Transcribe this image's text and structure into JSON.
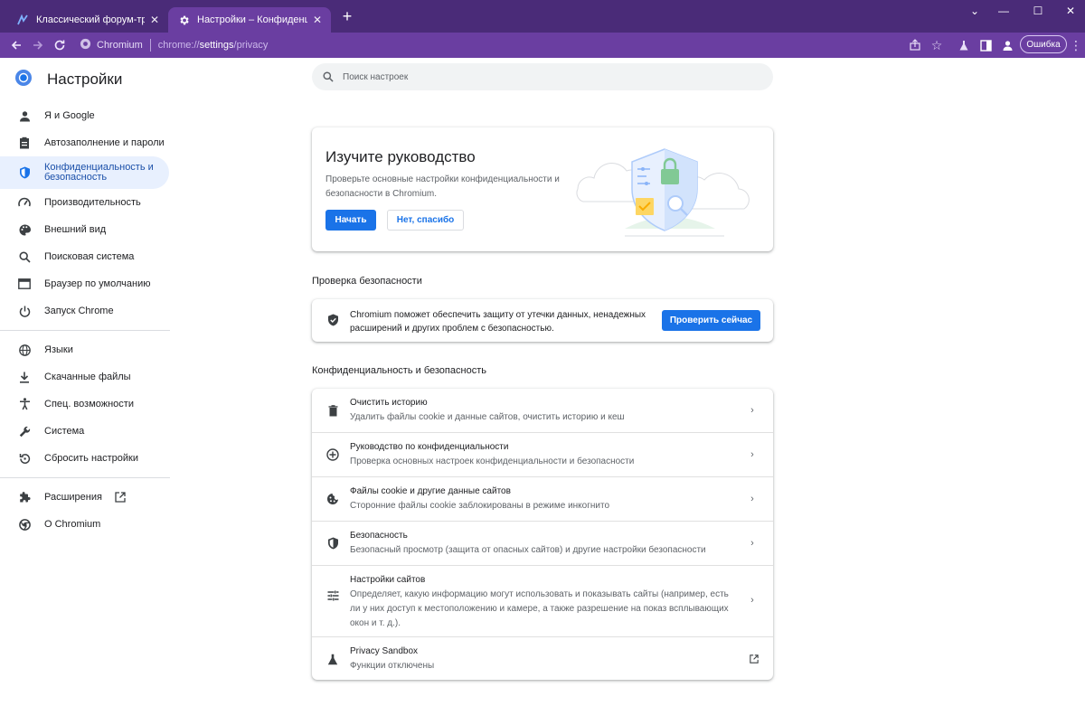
{
  "browser": {
    "tabs": [
      {
        "title": "Классический форум-трекер а",
        "active": false
      },
      {
        "title": "Настройки – Конфиденциальнс",
        "active": true
      }
    ],
    "omnibox": {
      "site": "Chromium",
      "url_prefix": "chrome://",
      "url_path": "settings",
      "url_suffix": "/privacy"
    },
    "error_button": "Ошибка",
    "colors": {
      "frame": "#4a2b78",
      "toolbar": "#6a3ea1"
    }
  },
  "sidebar": {
    "title": "Настройки",
    "groups": [
      [
        {
          "label": "Я и Google",
          "icon": "person-icon"
        },
        {
          "label": "Автозаполнение и пароли",
          "icon": "clipboard-icon"
        },
        {
          "label": "Конфиденциальность и безопасность",
          "icon": "shield-icon",
          "active": true
        },
        {
          "label": "Производительность",
          "icon": "speedometer-icon"
        },
        {
          "label": "Внешний вид",
          "icon": "palette-icon"
        },
        {
          "label": "Поисковая система",
          "icon": "search-icon"
        },
        {
          "label": "Браузер по умолчанию",
          "icon": "browser-icon"
        },
        {
          "label": "Запуск Chrome",
          "icon": "power-icon"
        }
      ],
      [
        {
          "label": "Языки",
          "icon": "globe-icon"
        },
        {
          "label": "Скачанные файлы",
          "icon": "download-icon"
        },
        {
          "label": "Спец. возможности",
          "icon": "accessibility-icon"
        },
        {
          "label": "Система",
          "icon": "wrench-icon"
        },
        {
          "label": "Сбросить настройки",
          "icon": "reset-icon"
        }
      ],
      [
        {
          "label": "Расширения",
          "icon": "puzzle-icon"
        },
        {
          "label": "О Chromium",
          "icon": "chromium-icon"
        }
      ]
    ]
  },
  "search": {
    "placeholder": "Поиск настроек"
  },
  "guide": {
    "title": "Изучите руководство",
    "description": "Проверьте основные настройки конфиденциальности и безопасности в Chromium.",
    "start_label": "Начать",
    "decline_label": "Нет, спасибо"
  },
  "safety_check": {
    "section_title": "Проверка безопасности",
    "text": "Chromium поможет обеспечить защиту от утечки данных, ненадежных расширений и других проблем с безопасностью.",
    "button_label": "Проверить сейчас"
  },
  "privacy": {
    "section_title": "Конфиденциальность и безопасность",
    "rows": [
      {
        "title": "Очистить историю",
        "subtitle": "Удалить файлы cookie и данные сайтов, очистить историю и кеш",
        "icon": "trash-icon"
      },
      {
        "title": "Руководство по конфиденциальности",
        "subtitle": "Проверка основных настроек конфиденциальности и безопасности",
        "icon": "add-circle-icon"
      },
      {
        "title": "Файлы cookie и другие данные сайтов",
        "subtitle": "Сторонние файлы cookie заблокированы в режиме инкогнито",
        "icon": "cookie-icon"
      },
      {
        "title": "Безопасность",
        "subtitle": "Безопасный просмотр (защита от опасных сайтов) и другие настройки безопасности",
        "icon": "shield-icon"
      },
      {
        "title": "Настройки сайтов",
        "subtitle": "Определяет, какую информацию могут использовать и показывать сайты (например, есть ли у них доступ к местоположению и камере, а также разрешение на показ всплывающих окон и т. д.).",
        "icon": "tune-icon"
      },
      {
        "title": "Privacy Sandbox",
        "subtitle": "Функции отключены",
        "icon": "flask-icon"
      }
    ]
  }
}
